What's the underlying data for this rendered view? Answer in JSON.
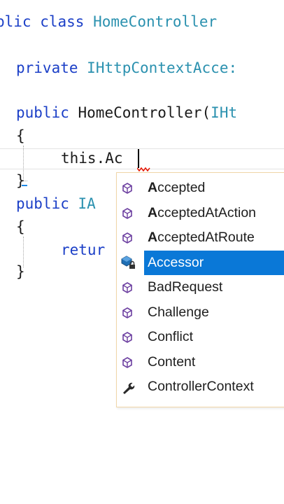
{
  "editor": {
    "lines": {
      "class_decl": {
        "kw_public_partial": "blic",
        "kw_class": "class",
        "class_name": "HomeController"
      },
      "field_decl": {
        "kw_private": "private",
        "field_type": "IHttpContextAcce:"
      },
      "ctor_decl": {
        "kw_public": "public",
        "ctor_name": "HomeController(",
        "param_type": "IHt"
      },
      "open_brace_1": "{",
      "current_line": {
        "text": "this.Ac"
      },
      "close_brace_1": "}",
      "method_decl": {
        "kw_public": "public",
        "return_type": "IA"
      },
      "open_brace_2": "{",
      "return_line": {
        "kw_return": "retur"
      },
      "close_brace_2": "}"
    }
  },
  "completion_list": {
    "typed_prefix": "Ac",
    "selected_index": 3,
    "items": [
      {
        "match": "A",
        "rest": "ccepted",
        "icon": "method-cube-icon"
      },
      {
        "match": "A",
        "rest": "cceptedAtAction",
        "icon": "method-cube-icon"
      },
      {
        "match": "A",
        "rest": "cceptedAtRoute",
        "icon": "method-cube-icon"
      },
      {
        "match": "",
        "rest": "Accessor",
        "icon": "private-field-lock-icon"
      },
      {
        "match": "",
        "rest": "BadRequest",
        "icon": "method-cube-icon"
      },
      {
        "match": "",
        "rest": "Challenge",
        "icon": "method-cube-icon"
      },
      {
        "match": "",
        "rest": "Conflict",
        "icon": "method-cube-icon"
      },
      {
        "match": "",
        "rest": "Content",
        "icon": "method-cube-icon"
      },
      {
        "match": "",
        "rest": "ControllerContext",
        "icon": "property-wrench-icon"
      }
    ]
  },
  "colors": {
    "keyword": "#1b3fc7",
    "type": "#2b91af",
    "selection": "#0a78d7",
    "method_icon": "#6c3fa0",
    "squiggle": "#e51400"
  }
}
